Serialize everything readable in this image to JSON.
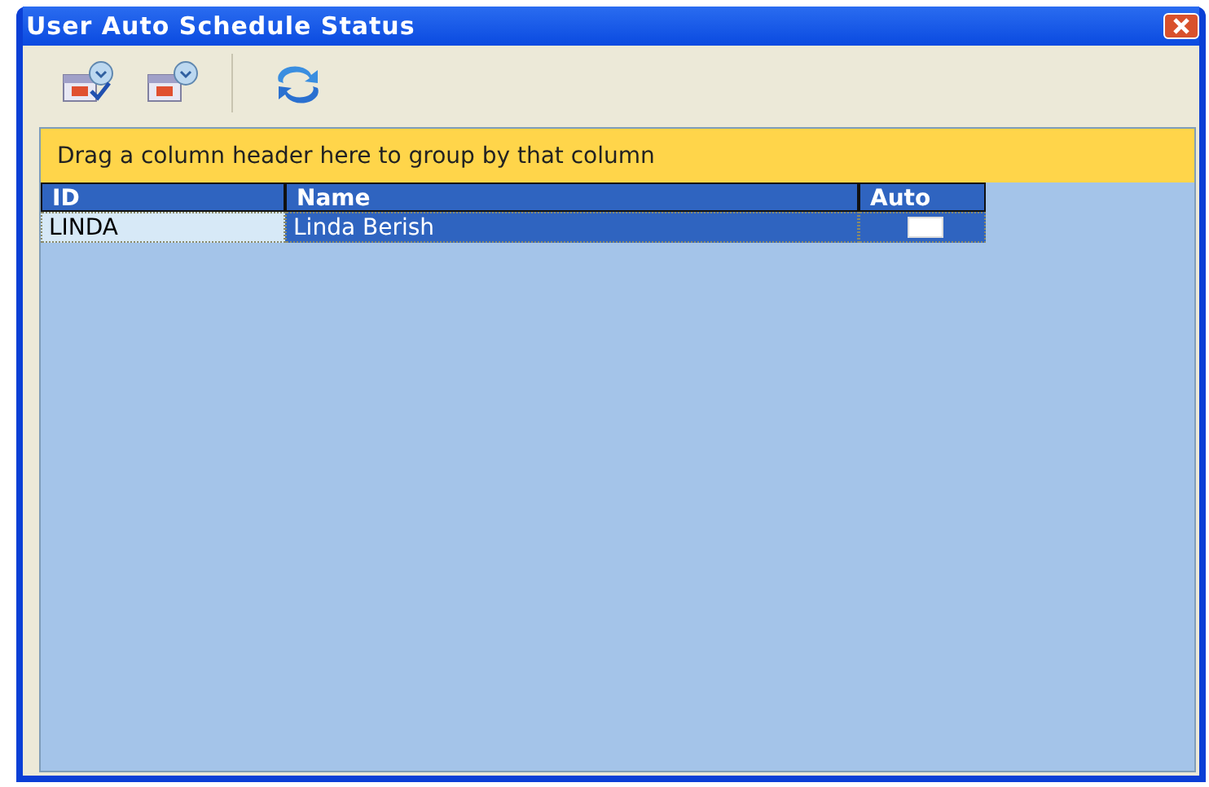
{
  "window": {
    "title": "User Auto Schedule Status"
  },
  "toolbar": {
    "buttons": [
      {
        "kind": "schedule-check"
      },
      {
        "kind": "schedule"
      },
      {
        "kind": "refresh"
      }
    ]
  },
  "group_panel": {
    "text": "Drag a column header here to group by that column"
  },
  "table": {
    "columns": [
      "ID",
      "Name",
      "Auto"
    ],
    "rows": [
      {
        "id": "LINDA",
        "name": "Linda Berish",
        "auto": false,
        "selected": true
      }
    ]
  }
}
